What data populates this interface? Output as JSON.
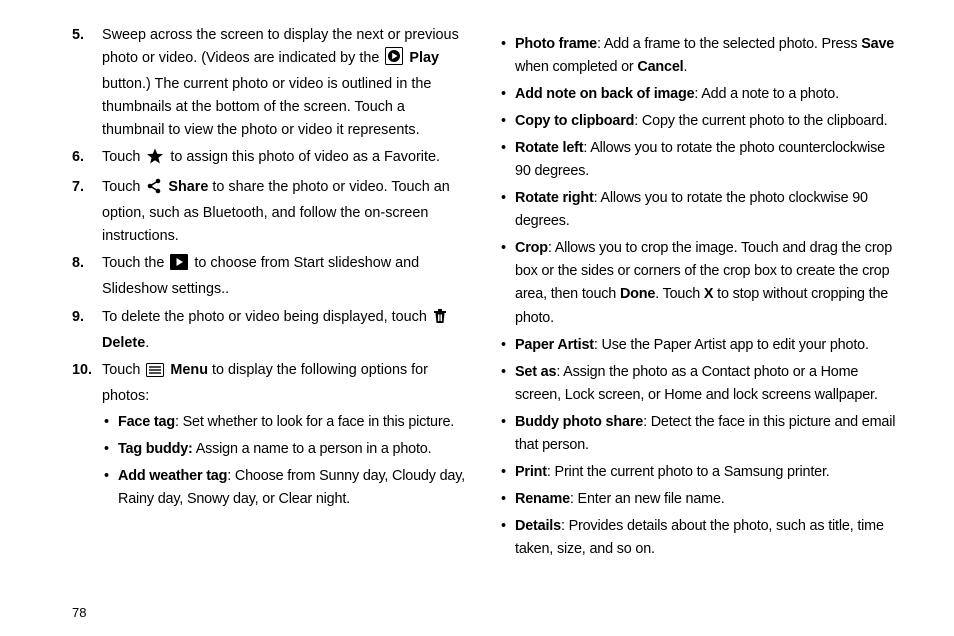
{
  "page_number": "78",
  "items": [
    {
      "num": "5.",
      "pre": "Sweep across the screen to display the next or previous photo or video. (Videos are indicated by the ",
      "bold1": "Play",
      "post": " button.) The current photo or video is outlined in the thumbnails at the bottom of the screen. Touch a thumbnail to view the photo or video it represents."
    },
    {
      "num": "6.",
      "pre": "Touch ",
      "post": " to assign this photo of video as a Favorite."
    },
    {
      "num": "7.",
      "pre": "Touch ",
      "bold1": "Share",
      "post": " to share the photo or video. Touch an option, such as Bluetooth, and follow the on-screen instructions."
    },
    {
      "num": "8.",
      "pre": "Touch the ",
      "post": " to choose from Start slideshow and Slideshow settings.."
    },
    {
      "num": "9.",
      "pre": "To delete the photo or video being displayed, touch ",
      "bold1": "Delete",
      "post": "."
    },
    {
      "num": "10.",
      "pre": "Touch ",
      "bold1": "Menu",
      "post": " to display the following options for photos:"
    }
  ],
  "left_bullets": [
    {
      "bold": "Face tag",
      "rest": ": Set whether to look for a face in this picture."
    },
    {
      "bold": "Tag buddy:",
      "rest": " Assign a name to a person in a photo."
    },
    {
      "bold": "Add weather tag",
      "rest": ": Choose from Sunny day, Cloudy day, Rainy day, Snowy day, or Clear night."
    }
  ],
  "right_bullets": [
    {
      "bold": "Photo frame",
      "rest_pre": ": Add a frame to the selected photo. Press ",
      "bold2": "Save",
      "rest_mid": " when completed or ",
      "bold3": "Cancel",
      "rest_post": "."
    },
    {
      "bold": "Add note on back of image",
      "rest": ": Add a note to a photo."
    },
    {
      "bold": "Copy to clipboard",
      "rest": ": Copy the current photo to the clipboard."
    },
    {
      "bold": "Rotate left",
      "rest": ": Allows you to rotate the photo counterclockwise 90 degrees."
    },
    {
      "bold": "Rotate right",
      "rest": ": Allows you to rotate the photo clockwise 90 degrees."
    },
    {
      "bold": "Crop",
      "rest_pre": ": Allows you to crop the image. Touch and drag the crop box or the sides or corners of the crop box to create the crop area, then touch ",
      "bold2": "Done",
      "rest_mid": ". Touch ",
      "bold3": "X",
      "rest_post": " to stop without cropping the photo."
    },
    {
      "bold": "Paper Artist",
      "rest": ": Use the Paper Artist app to edit your photo."
    },
    {
      "bold": "Set as",
      "rest": ": Assign the photo as a Contact photo or a Home screen, Lock screen, or Home and lock screens wallpaper."
    },
    {
      "bold": "Buddy photo share",
      "rest": ": Detect the face in this picture and email that person."
    },
    {
      "bold": "Print",
      "rest": ": Print the current photo to a Samsung printer."
    },
    {
      "bold": "Rename",
      "rest": ": Enter an new file name."
    },
    {
      "bold": "Details",
      "rest": ": Provides details about the photo, such as title, time taken, size, and so on."
    }
  ]
}
